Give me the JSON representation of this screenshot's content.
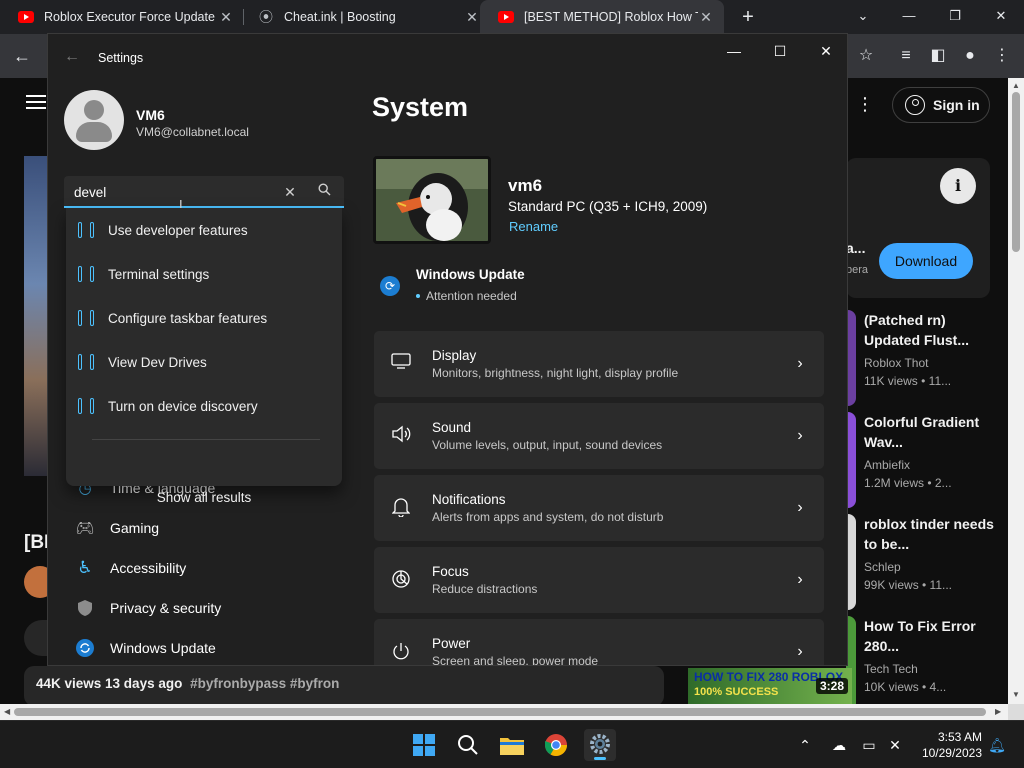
{
  "browser": {
    "tabs": [
      {
        "title": "Roblox Executor Force Update B",
        "favicon": "youtube-icon",
        "active": false
      },
      {
        "title": "Cheat.ink | Boosting",
        "favicon": "cheatink-icon",
        "active": false
      },
      {
        "title": "[BEST METHOD] Roblox How To",
        "favicon": "youtube-icon",
        "active": true
      }
    ]
  },
  "youtube": {
    "sign_in": "Sign in",
    "ad_title": "a...",
    "ad_sub": "pera",
    "download_label": "Download",
    "left_title": "[BE",
    "description": "44K views  13 days ago",
    "description_tags": "#byfronbypass #byfron",
    "recommendations": [
      {
        "title": "(Patched rn) Updated Flust...",
        "channel": "Roblox Thot",
        "meta": "11K views • 11...",
        "color": "#6b3fa0"
      },
      {
        "title": "Colorful Gradient Wav...",
        "channel": "Ambiefix",
        "meta": "1.2M views • 2...",
        "color": "#8a4fd8"
      },
      {
        "title": "roblox tinder needs to be...",
        "channel": "Schlep",
        "meta": "99K views • 11...",
        "color": "#d8d8d8"
      },
      {
        "title": "How To Fix Error 280...",
        "channel": "Tech Tech",
        "meta": "10K views • 4...",
        "color": "#4c9a3a"
      }
    ],
    "last_thumb_text": "HOW TO FIX 280 ROBLOX",
    "last_thumb_text2": "100% SUCCESS",
    "last_thumb_duration": "3:28"
  },
  "settings": {
    "window_title": "Settings",
    "user_name": "VM6",
    "user_email": "VM6@collabnet.local",
    "search_value": "devel",
    "suggestions": [
      "Use developer features",
      "Terminal settings",
      "Configure taskbar features",
      "View Dev Drives",
      "Turn on device discovery"
    ],
    "show_all": "Show all results",
    "nav": [
      {
        "label": "Time & language",
        "icon": "clock-globe-icon"
      },
      {
        "label": "Gaming",
        "icon": "gamepad-icon"
      },
      {
        "label": "Accessibility",
        "icon": "accessibility-icon"
      },
      {
        "label": "Privacy & security",
        "icon": "shield-icon"
      },
      {
        "label": "Windows Update",
        "icon": "windows-update-icon"
      }
    ],
    "page_title": "System",
    "device_name": "vm6",
    "device_model": "Standard PC (Q35 + ICH9, 2009)",
    "rename_label": "Rename",
    "windows_update_title": "Windows Update",
    "windows_update_status": "Attention needed",
    "cards": [
      {
        "title": "Display",
        "sub": "Monitors, brightness, night light, display profile",
        "icon": "monitor-icon"
      },
      {
        "title": "Sound",
        "sub": "Volume levels, output, input, sound devices",
        "icon": "speaker-icon"
      },
      {
        "title": "Notifications",
        "sub": "Alerts from apps and system, do not disturb",
        "icon": "bell-icon"
      },
      {
        "title": "Focus",
        "sub": "Reduce distractions",
        "icon": "focus-icon"
      },
      {
        "title": "Power",
        "sub": "Screen and sleep, power mode",
        "icon": "power-icon"
      }
    ],
    "accent": "#4cc2ff"
  },
  "taskbar": {
    "time": "3:53 AM",
    "date": "10/29/2023"
  }
}
